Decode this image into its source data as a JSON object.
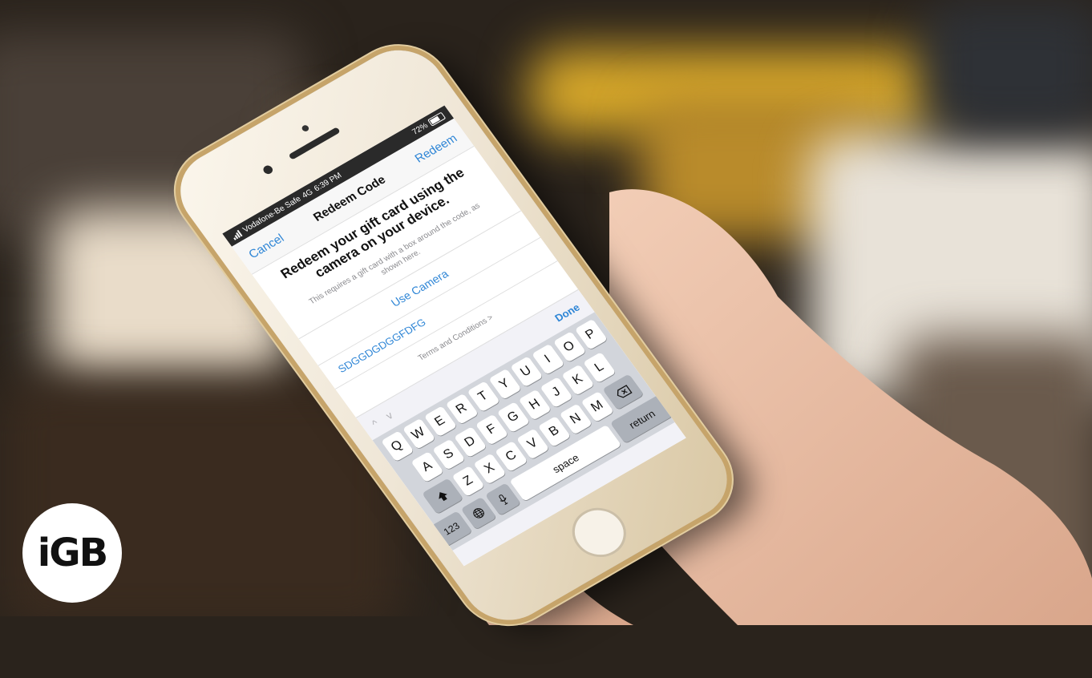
{
  "status_bar": {
    "carrier": "Vodafone-Be Safe",
    "network": "4G",
    "time": "6:39 PM",
    "battery": "72%"
  },
  "navbar": {
    "cancel_label": "Cancel",
    "title": "Redeem Code",
    "redeem_label": "Redeem"
  },
  "content": {
    "headline": "Redeem your gift card using the camera on your device.",
    "subtext": "This requires a gift card with a box around the code, as shown here.",
    "use_camera_label": "Use Camera",
    "code_value": "SDGGDGDGGFDFG",
    "terms_label": "Terms and Conditions >"
  },
  "accessory": {
    "up_arrow": "^",
    "down_arrow": "v",
    "done_label": "Done"
  },
  "keyboard": {
    "row1": [
      "Q",
      "W",
      "E",
      "R",
      "T",
      "Y",
      "U",
      "I",
      "O",
      "P"
    ],
    "row2": [
      "A",
      "S",
      "D",
      "F",
      "G",
      "H",
      "J",
      "K",
      "L"
    ],
    "row3": [
      "Z",
      "X",
      "C",
      "V",
      "B",
      "N",
      "M"
    ],
    "shift_icon": "shift-icon",
    "backspace_icon": "backspace-icon",
    "numbers_label": "123",
    "globe_icon": "globe-icon",
    "mic_icon": "microphone-icon",
    "space_label": "space",
    "return_label": "return"
  },
  "logo": {
    "text": "iGB"
  },
  "colors": {
    "accent": "#2f86d6"
  }
}
